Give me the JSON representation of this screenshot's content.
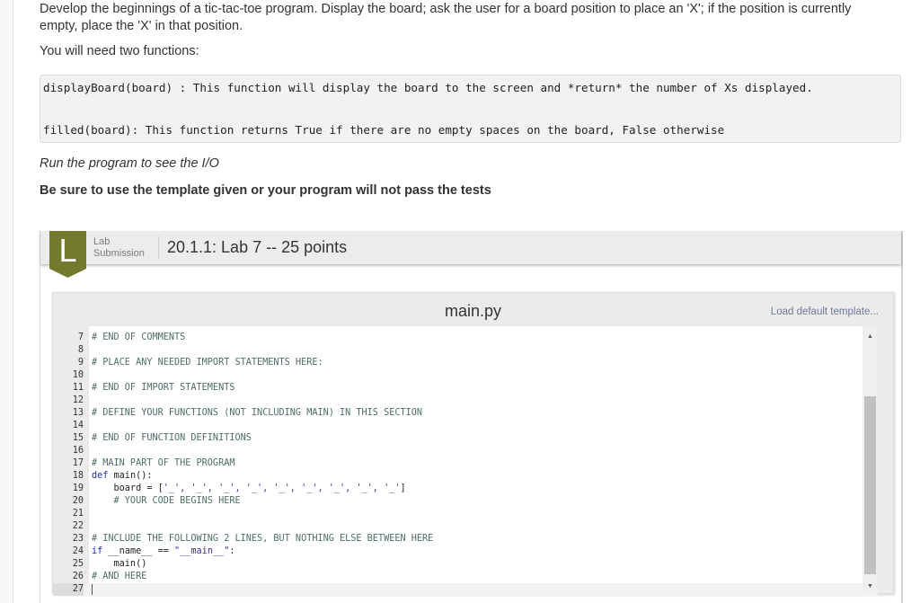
{
  "instructions": {
    "intro": "Develop the beginnings of a tic-tac-toe program. Display the board; ask the user for a board position to place an 'X'; if the position is currently empty, place the 'X' in that position.",
    "functions_heading": "You will need two functions:",
    "function_specs": [
      "displayBoard(board) : This function will display the board to the screen and *return* the number of Xs displayed.",
      "filled(board): This function returns True if there are no empty spaces on the board, False otherwise"
    ],
    "run_note": "Run the program to see the I/O",
    "warning": "Be sure to use the template given or your program will not pass the tests"
  },
  "lab": {
    "badge_letter": "L",
    "badge_color": "#727a2d",
    "kind_line1": "Lab",
    "kind_line2": "Submission",
    "title": "20.1.1: Lab 7 -- 25 points"
  },
  "editor": {
    "file_name": "main.py",
    "load_template_label": "Load default template...",
    "scroll_up_icon": "triangle-up",
    "scroll_down_icon": "triangle-down",
    "lines": [
      {
        "n": "7",
        "tokens": [
          {
            "t": "# END OF COMMENTS",
            "c": "comment"
          }
        ]
      },
      {
        "n": "8",
        "tokens": []
      },
      {
        "n": "9",
        "tokens": [
          {
            "t": "# PLACE ANY NEEDED IMPORT STATEMENTS HERE:",
            "c": "comment"
          }
        ]
      },
      {
        "n": "10",
        "tokens": []
      },
      {
        "n": "11",
        "tokens": [
          {
            "t": "# END OF IMPORT STATEMENTS",
            "c": "comment"
          }
        ]
      },
      {
        "n": "12",
        "tokens": []
      },
      {
        "n": "13",
        "tokens": [
          {
            "t": "# DEFINE YOUR FUNCTIONS (NOT INCLUDING MAIN) IN THIS SECTION",
            "c": "comment"
          }
        ]
      },
      {
        "n": "14",
        "tokens": []
      },
      {
        "n": "15",
        "tokens": [
          {
            "t": "# END OF FUNCTION DEFINITIONS",
            "c": "comment"
          }
        ]
      },
      {
        "n": "16",
        "tokens": []
      },
      {
        "n": "17",
        "tokens": [
          {
            "t": "# MAIN PART OF THE PROGRAM",
            "c": "comment"
          }
        ]
      },
      {
        "n": "18",
        "tokens": [
          {
            "t": "def",
            "c": "kw"
          },
          {
            "t": " main():",
            "c": "plain"
          }
        ]
      },
      {
        "n": "19",
        "tokens": [
          {
            "t": "    board = [",
            "c": "plain"
          },
          {
            "t": "'_', '_', '_', '_', '_', '_', '_', '_', '_'",
            "c": "str"
          },
          {
            "t": "]",
            "c": "plain"
          }
        ]
      },
      {
        "n": "20",
        "tokens": [
          {
            "t": "    # YOUR CODE BEGINS HERE",
            "c": "comment"
          }
        ]
      },
      {
        "n": "21",
        "tokens": []
      },
      {
        "n": "22",
        "tokens": []
      },
      {
        "n": "23",
        "tokens": [
          {
            "t": "# INCLUDE THE FOLLOWING 2 LINES, BUT NOTHING ELSE BETWEEN HERE",
            "c": "comment"
          }
        ]
      },
      {
        "n": "24",
        "tokens": [
          {
            "t": "if",
            "c": "kw"
          },
          {
            "t": " __name__ == ",
            "c": "plain"
          },
          {
            "t": "\"__main__\"",
            "c": "str"
          },
          {
            "t": ":",
            "c": "plain"
          }
        ]
      },
      {
        "n": "25",
        "tokens": [
          {
            "t": "    main()",
            "c": "plain"
          }
        ]
      },
      {
        "n": "26",
        "tokens": [
          {
            "t": "# AND HERE",
            "c": "comment"
          }
        ]
      },
      {
        "n": "27",
        "tokens": [],
        "active": true
      }
    ]
  }
}
